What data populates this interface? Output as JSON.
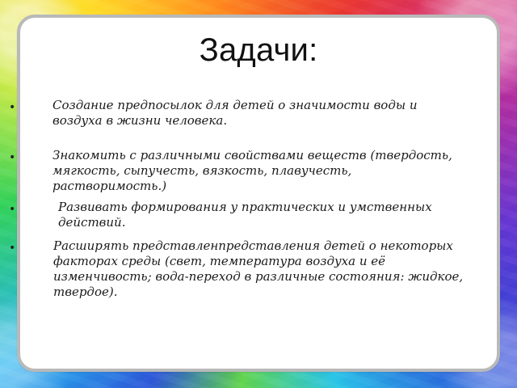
{
  "slide": {
    "title": "Задачи:",
    "bullet_marker": "•",
    "items": [
      "Создание предпосылок для детей о значимости воды и воздуха в жизни человека.",
      "Знакомить с различными свойствами веществ (твердость, мягкость, сыпучесть, вязкость, плавучесть, растворимость.)",
      "Развивать формирования у практических и умственных действий.",
      "Расширять представленпредставления детей о некоторых факторах среды (свет, температура воздуха и её изменчивость; вода-переход в различные состояния: жидкое, твердое)."
    ]
  },
  "colors": {
    "panel_background": "#ffffff",
    "panel_border": "#b9b9b9",
    "text": "#111111",
    "background_accents": [
      "#2f57d8",
      "#28b4ef",
      "#33d15b",
      "#ffdd2a",
      "#ff8a1f",
      "#ea3932",
      "#c92c93",
      "#6737d2"
    ]
  }
}
